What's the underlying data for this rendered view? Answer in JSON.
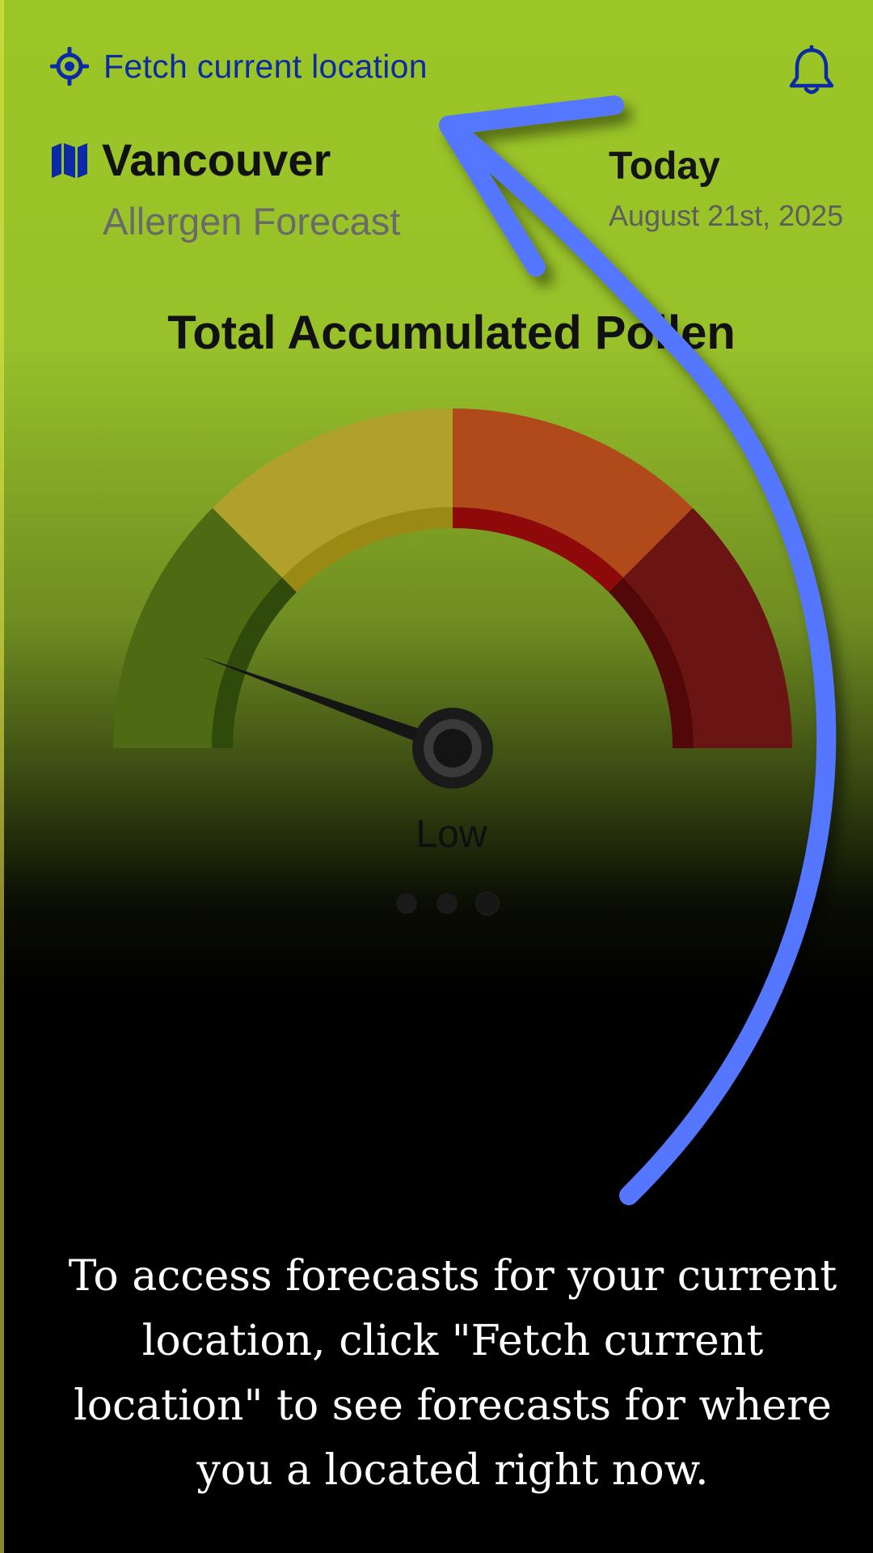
{
  "header": {
    "fetch_location_label": "Fetch current location",
    "location_icon": "crosshair-location-icon",
    "notification_icon": "bell-icon"
  },
  "location": {
    "city": "Vancouver",
    "subtitle": "Allergen Forecast",
    "map_icon": "map-icon"
  },
  "date_panel": {
    "label": "Today",
    "date": "August 21st, 2025"
  },
  "gauge": {
    "title": "Total Accumulated Pollen",
    "level_label": "Low",
    "segments": [
      {
        "name": "low",
        "color": "#4e6a12"
      },
      {
        "name": "moderate",
        "color": "#b0a02c"
      },
      {
        "name": "high",
        "color": "#b04a1a"
      },
      {
        "name": "very-high",
        "color": "#6a1414"
      }
    ],
    "needle_fraction": 0.1
  },
  "pagination": {
    "pages": 3,
    "active_index": 2
  },
  "tutorial": {
    "text": "To access forecasts for your current location, click \"Fetch current location\" to see forecasts for where you a located right now.",
    "arrow_color": "#5577ff"
  }
}
